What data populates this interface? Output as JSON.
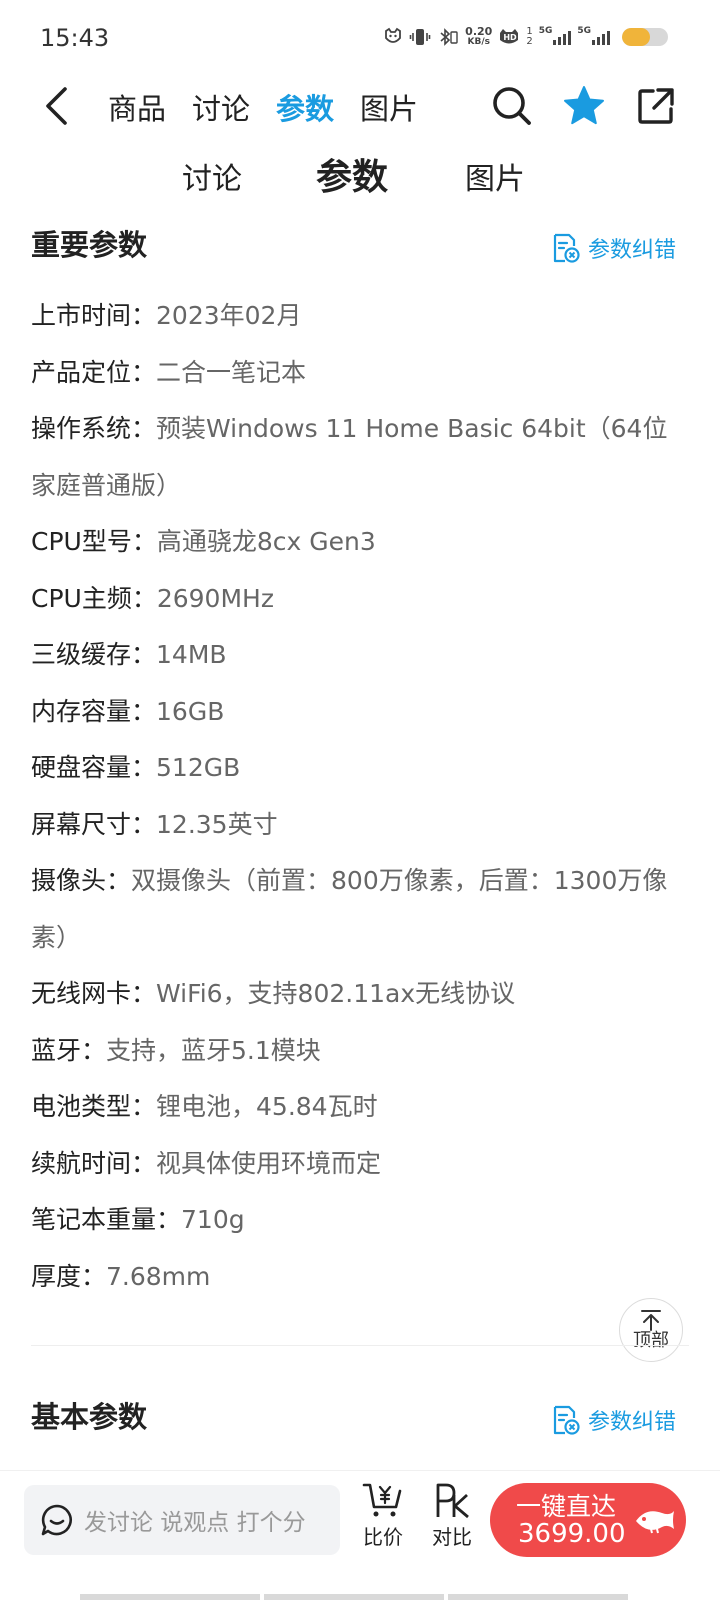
{
  "status_bar": {
    "time": "15:43",
    "net_speed_value": "0.20",
    "net_speed_unit": "KB/s",
    "hd_label": "HD",
    "sim1_label": "5G",
    "sim2_label": "5G",
    "battery_level": 0.6,
    "battery_color": "#f0b43a"
  },
  "header": {
    "tabs": [
      {
        "label": "商品",
        "active": false
      },
      {
        "label": "讨论",
        "active": false
      },
      {
        "label": "参数",
        "active": true
      },
      {
        "label": "图片",
        "active": false
      }
    ],
    "icons": [
      "back-icon",
      "search-icon",
      "star-icon",
      "share-icon"
    ],
    "accent_color": "#1a9be0"
  },
  "subtabs": [
    {
      "label": "讨论"
    },
    {
      "label": "参数",
      "active": true
    },
    {
      "label": "图片"
    }
  ],
  "important_params": {
    "title": "重要参数",
    "fix_label": "参数纠错",
    "rows": [
      {
        "key": "上市时间：",
        "value": "2023年02月"
      },
      {
        "key": "产品定位：",
        "value": "二合一笔记本"
      },
      {
        "key": "操作系统：",
        "value": "预装Windows 11 Home Basic 64bit（64位家庭普通版）"
      },
      {
        "key": "CPU型号：",
        "value": "高通骁龙8cx Gen3"
      },
      {
        "key": "CPU主频：",
        "value": "2690MHz"
      },
      {
        "key": "三级缓存：",
        "value": "14MB"
      },
      {
        "key": "内存容量：",
        "value": "16GB"
      },
      {
        "key": "硬盘容量：",
        "value": "512GB"
      },
      {
        "key": "屏幕尺寸：",
        "value": "12.35英寸"
      },
      {
        "key": "摄像头：",
        "value": "双摄像头（前置：800万像素，后置：1300万像素）"
      },
      {
        "key": "无线网卡：",
        "value": "WiFi6，支持802.11ax无线协议"
      },
      {
        "key": "蓝牙：",
        "value": "支持，蓝牙5.1模块"
      },
      {
        "key": "电池类型：",
        "value": "锂电池，45.84瓦时"
      },
      {
        "key": "续航时间：",
        "value": "视具体使用环境而定"
      },
      {
        "key": "笔记本重量：",
        "value": "710g"
      },
      {
        "key": "厚度：",
        "value": "7.68mm"
      }
    ]
  },
  "back_to_top": {
    "label": "顶部"
  },
  "basic_params": {
    "title": "基本参数",
    "fix_label": "参数纠错"
  },
  "bottom_bar": {
    "comment_placeholder": "发讨论 说观点 打个分",
    "compare_price_label": "比价",
    "pk_label": "对比",
    "buy_line1": "一键直达",
    "buy_price": "3699.00",
    "buy_color": "#f04a4a"
  }
}
